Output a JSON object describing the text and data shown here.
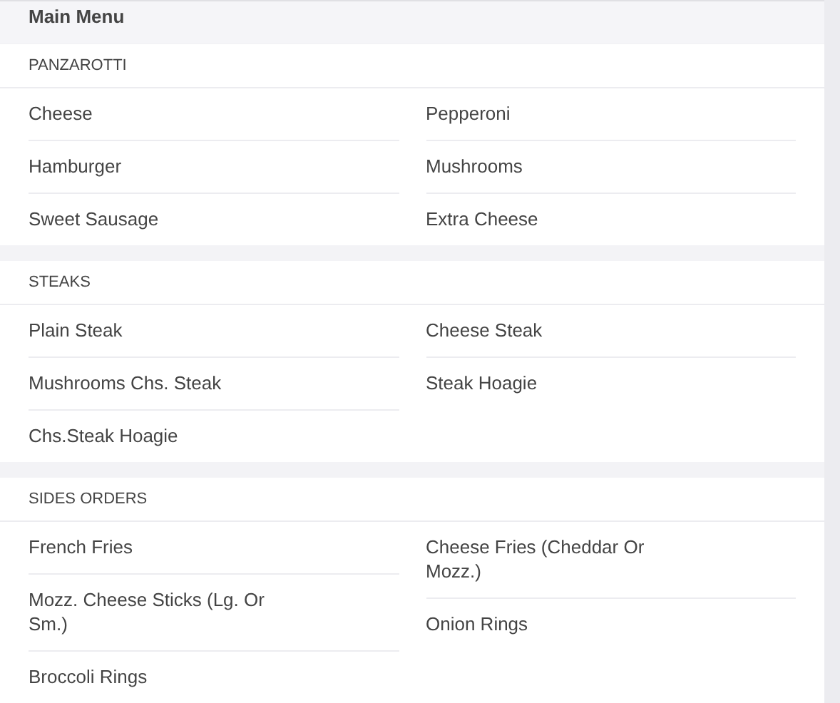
{
  "menu": {
    "title": "Main Menu"
  },
  "sections": [
    {
      "title": "PANZAROTTI",
      "items": [
        "Cheese",
        "Pepperoni",
        "Hamburger",
        "Mushrooms",
        "Sweet Sausage",
        "Extra Cheese"
      ]
    },
    {
      "title": "STEAKS",
      "items": [
        "Plain Steak",
        "Cheese Steak",
        "Mushrooms Chs. Steak",
        "Steak Hoagie",
        "Chs.Steak Hoagie"
      ]
    },
    {
      "title": "SIDES ORDERS",
      "items": [
        "French Fries",
        "Cheese Fries (Cheddar Or Mozz.)",
        "Mozz. Cheese Sticks (Lg. Or Sm.)",
        "Onion Rings",
        "Broccoli Rings"
      ]
    }
  ]
}
